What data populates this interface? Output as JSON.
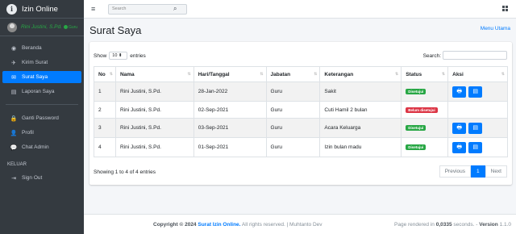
{
  "brand": {
    "logo": "i",
    "title": "Izin Online"
  },
  "user": {
    "name": "Rini Justini, S.Pd.",
    "status": "Guru"
  },
  "sidebar": {
    "items": [
      {
        "icon": "dashboard-icon",
        "glyph": "◉",
        "label": "Beranda"
      },
      {
        "icon": "send-icon",
        "glyph": "✈",
        "label": "Kirim Surat"
      },
      {
        "icon": "envelope-icon",
        "glyph": "✉",
        "label": "Surat Saya",
        "active": true
      },
      {
        "icon": "document-icon",
        "glyph": "▤",
        "label": "Laporan Saya"
      }
    ],
    "items2": [
      {
        "icon": "lock-icon",
        "glyph": "🔒",
        "label": "Ganti Password"
      },
      {
        "icon": "user-icon",
        "glyph": "👤",
        "label": "Profil"
      },
      {
        "icon": "chat-icon",
        "glyph": "💬",
        "label": "Chat Admin"
      }
    ],
    "header_keluar": "KELUAR",
    "signout": {
      "icon": "sign-out-icon",
      "glyph": "⇥",
      "label": "Sign Out"
    }
  },
  "topbar": {
    "search_placeholder": "Search"
  },
  "page": {
    "title": "Surat Saya",
    "home_link": "Menu Utama"
  },
  "table_controls": {
    "show": "Show",
    "length_value": "10",
    "entries": "entries",
    "search_label": "Search:"
  },
  "table": {
    "headers": [
      "No",
      "Nama",
      "Hari/Tanggal",
      "Jabatan",
      "Keterangan",
      "Status",
      "Aksi"
    ],
    "rows": [
      {
        "no": "1",
        "nama": "Rini Justini, S.Pd.",
        "tanggal": "28-Jan-2022",
        "jabatan": "Guru",
        "keterangan": "Sakit",
        "status": "Disetujui",
        "status_color": "green",
        "actions": true
      },
      {
        "no": "2",
        "nama": "Rini Justini, S.Pd.",
        "tanggal": "02-Sep-2021",
        "jabatan": "Guru",
        "keterangan": "Cuti Hamil 2 bulan",
        "status": "Belum disetujui",
        "status_color": "red",
        "actions": false
      },
      {
        "no": "3",
        "nama": "Rini Justini, S.Pd.",
        "tanggal": "03-Sep-2021",
        "jabatan": "Guru",
        "keterangan": "Acara Keluarga",
        "status": "Disetujui",
        "status_color": "green",
        "actions": true
      },
      {
        "no": "4",
        "nama": "Rini Justini, S.Pd.",
        "tanggal": "01-Sep-2021",
        "jabatan": "Guru",
        "keterangan": "Izin bulan madu",
        "status": "Disetujui",
        "status_color": "green",
        "actions": true
      }
    ]
  },
  "pagination": {
    "info": "Showing 1 to 4 of 4 entries",
    "previous": "Previous",
    "page": "1",
    "next": "Next"
  },
  "footer": {
    "copyright": "Copyright © 2024",
    "brand": "Surat Izin Online.",
    "rights": "All rights reserved. | Muhtanto Dev",
    "render_prefix": "Page rendered in",
    "render_time": "0,0335",
    "render_suffix": "seconds. -",
    "version_label": "Version",
    "version": "1.1.0"
  },
  "colors": {
    "primary": "#007bff",
    "sidebar": "#343a40",
    "success": "#28a745",
    "danger": "#dc3545"
  }
}
